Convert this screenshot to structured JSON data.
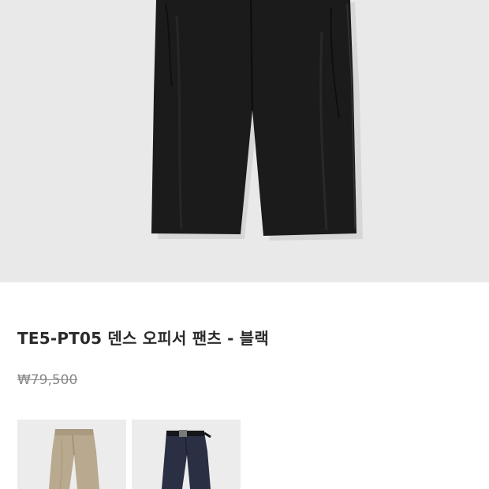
{
  "product": {
    "title": "TE5-PT05 덴스 오피서 팬츠 - 블랙",
    "price": "₩79,500",
    "main_image": "black-pants-photo",
    "thumbnails": [
      {
        "name": "beige-pants-thumbnail",
        "color": "#b9a98f"
      },
      {
        "name": "navy-pants-thumbnail",
        "color": "#2a2f44"
      }
    ]
  },
  "colors": {
    "hero_bg": "#e9e9e9",
    "pants": "#1b1b1b"
  }
}
